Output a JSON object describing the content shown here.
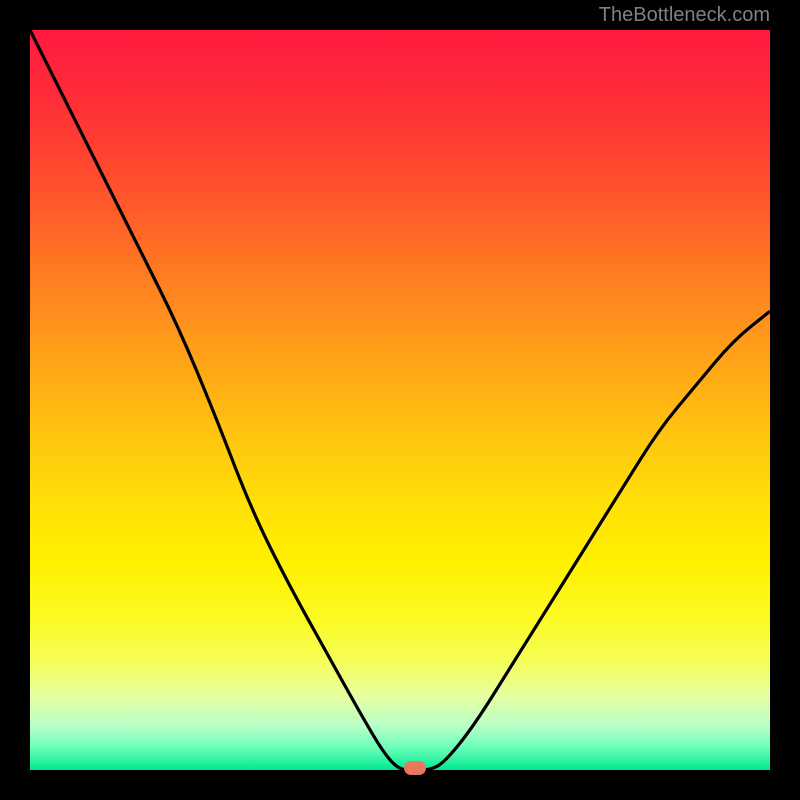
{
  "watermark": "TheBottleneck.com",
  "chart_data": {
    "type": "line",
    "title": "",
    "xlabel": "",
    "ylabel": "",
    "xlim": [
      0,
      100
    ],
    "ylim": [
      0,
      100
    ],
    "series": [
      {
        "name": "bottleneck-curve",
        "x": [
          0,
          5,
          10,
          15,
          20,
          25,
          30,
          35,
          40,
          45,
          48,
          50,
          52,
          54,
          56,
          60,
          65,
          70,
          75,
          80,
          85,
          90,
          95,
          100
        ],
        "values": [
          100,
          90,
          80,
          70,
          60,
          48,
          35,
          25,
          16,
          7,
          2,
          0,
          0,
          0,
          1,
          6,
          14,
          22,
          30,
          38,
          46,
          52,
          58,
          62
        ]
      }
    ],
    "marker": {
      "x": 52,
      "y": 0,
      "color": "#e8775f"
    },
    "background_gradient": {
      "top": "#ff1a3d",
      "mid": "#fff000",
      "bottom": "#00e890"
    }
  }
}
